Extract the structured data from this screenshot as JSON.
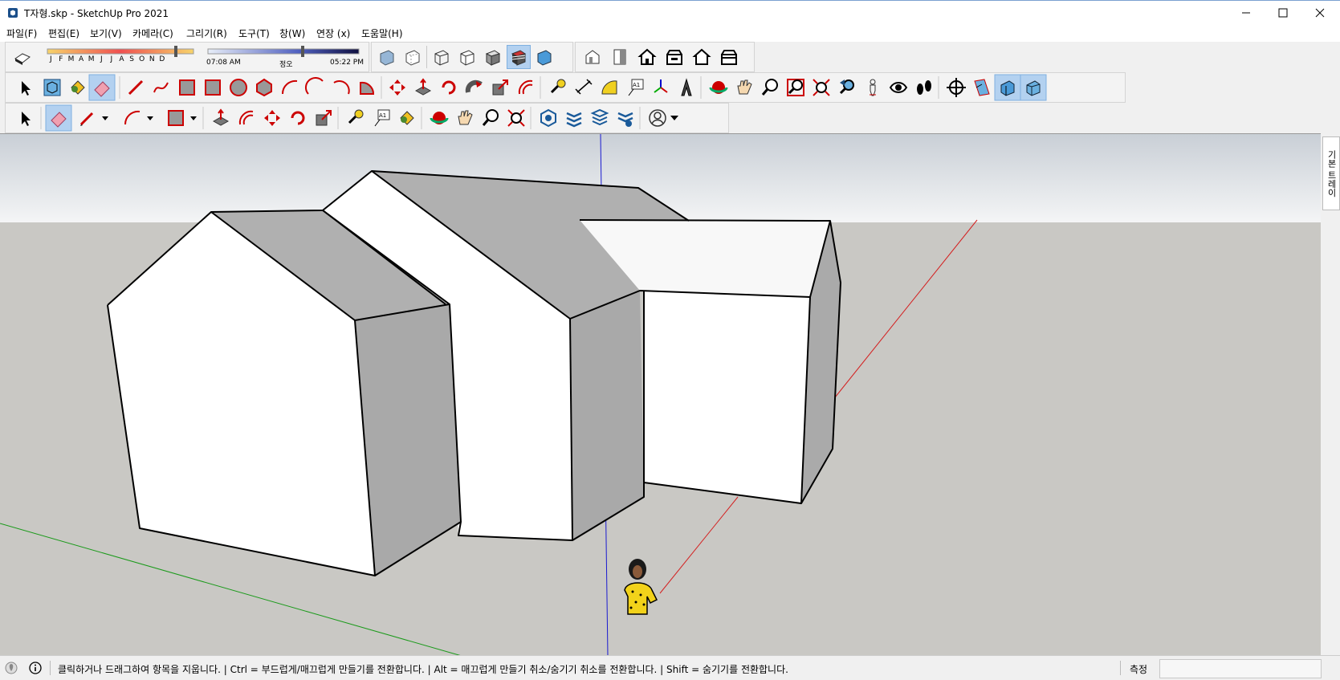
{
  "window": {
    "title": "T자형.skp - SketchUp Pro 2021",
    "minimize_icon": "minimize-icon",
    "maximize_icon": "maximize-icon",
    "close_icon": "close-icon"
  },
  "menu": [
    "파일(F)",
    "편집(E)",
    "보기(V)",
    "카메라(C)",
    "그리기(R)",
    "도구(T)",
    "창(W)",
    "연장 (x)",
    "도움말(H)"
  ],
  "shadows": {
    "months": [
      "J",
      "F",
      "M",
      "A",
      "M",
      "J",
      "J",
      "A",
      "S",
      "O",
      "N",
      "D"
    ],
    "time_start": "07:08 AM",
    "time_mid": "정오",
    "time_end": "05:22 PM"
  },
  "toolbars": {
    "row1_styles": [
      "xray-icon",
      "back-edges-icon",
      "wireframe-icon",
      "hidden-line-icon",
      "shaded-icon",
      "shaded-textures-icon",
      "monochrome-icon"
    ],
    "row1_views": [
      "iso-view-icon",
      "top-view-icon",
      "front-view-icon",
      "right-view-icon",
      "back-view-icon",
      "left-view-icon"
    ],
    "row2_tools": [
      "select-icon",
      "make-component-icon",
      "paint-bucket-icon",
      "eraser-icon",
      "line-icon",
      "freehand-icon",
      "rectangle-icon",
      "rotated-rectangle-icon",
      "circle-icon",
      "polygon-icon",
      "arc-icon",
      "two-point-arc-icon",
      "three-point-arc-icon",
      "pie-icon",
      "move-icon",
      "push-pull-icon",
      "rotate-icon",
      "follow-me-icon",
      "scale-icon",
      "offset-icon",
      "tape-measure-icon",
      "dimension-icon",
      "protractor-icon",
      "text-icon",
      "axes-icon",
      "3d-text-icon",
      "orbit-icon",
      "pan-icon",
      "zoom-icon",
      "zoom-window-icon",
      "zoom-extents-icon",
      "previous-view-icon",
      "position-camera-icon",
      "look-around-icon",
      "walk-icon",
      "section-plane-icon",
      "display-section-planes-icon",
      "display-section-cuts-icon",
      "display-section-fill-icon"
    ],
    "row3_tools": [
      "select-icon",
      "eraser-icon",
      "pencil-icon",
      "arc-icon",
      "rectangle-icon",
      "push-pull-icon",
      "offset-icon",
      "move-icon",
      "rotate-icon",
      "scale-icon",
      "tape-measure-icon",
      "text-icon",
      "paint-bucket-icon",
      "orbit-icon",
      "pan-icon",
      "zoom-icon",
      "zoom-extents-icon",
      "3d-warehouse-icon",
      "extension-warehouse-icon",
      "layout-icon",
      "extension-manager-icon",
      "account-icon"
    ]
  },
  "tray": {
    "label": "기본 트레이"
  },
  "status": {
    "info_icon": "info-icon",
    "geo_icon": "geolocation-icon",
    "text": "클릭하거나 드래그하여 항목을 지웁니다. | Ctrl = 부드럽게/매끄럽게 만들기를 전환합니다. | Alt = 매끄럽게 만들기 취소/숨기기 취소를 전환합니다. | Shift = 숨기기를 전환합니다.",
    "measure_label": "측정",
    "measure_value": ""
  },
  "colors": {
    "sky_top": "#cfd3d8",
    "ground": "#c9c8c4",
    "axis_red": "#d42020",
    "axis_green": "#1a9a1a",
    "axis_blue": "#1a1ad0",
    "face_light": "#ffffff",
    "face_shade": "#b0b0b0",
    "active_button": "#b3d1f0"
  }
}
